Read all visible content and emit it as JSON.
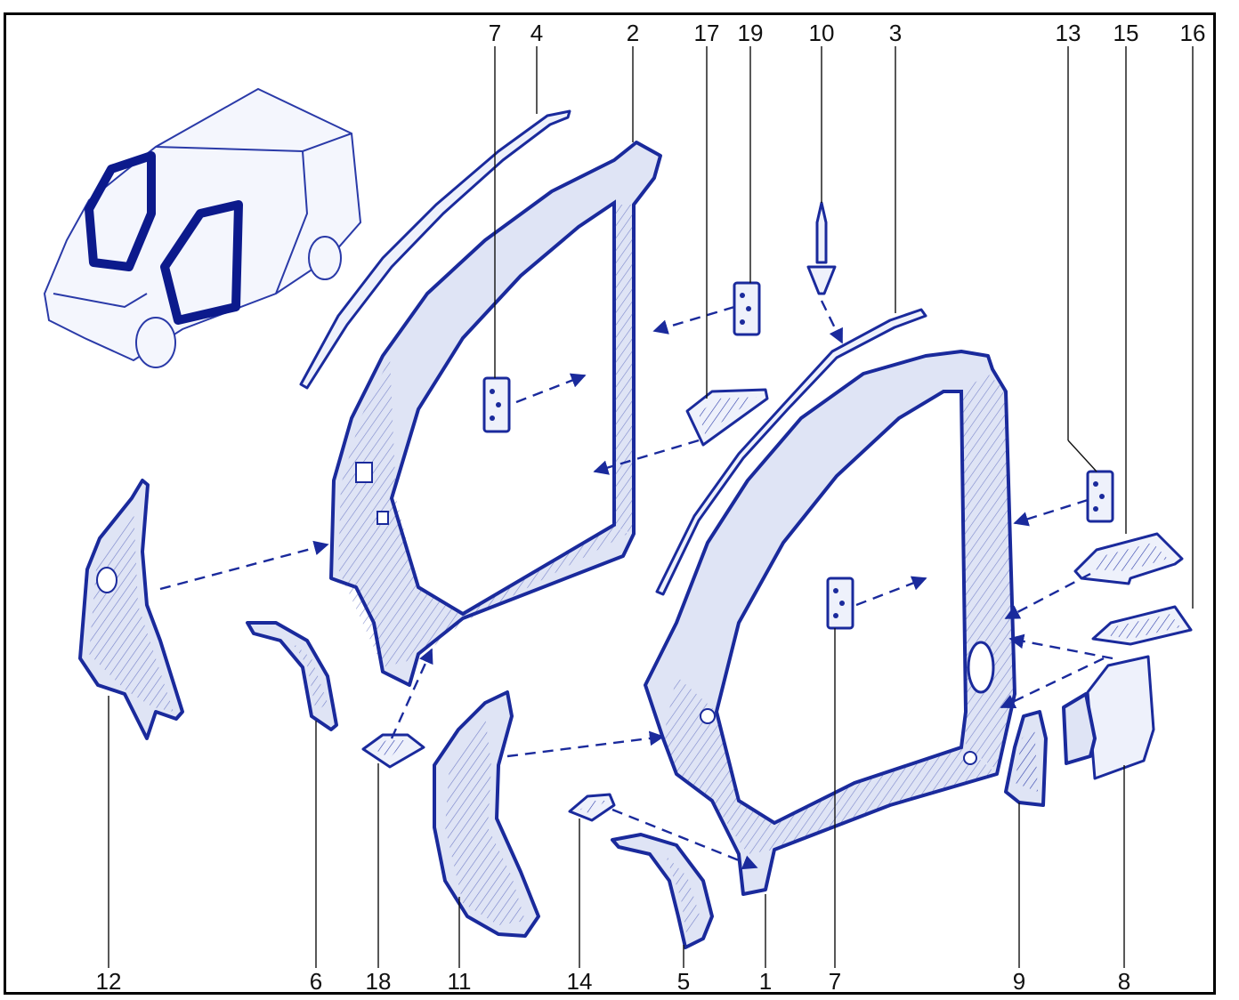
{
  "callouts": {
    "top": [
      "7",
      "4",
      "2",
      "17",
      "19",
      "10",
      "3",
      "13",
      "15",
      "16"
    ],
    "bottom": [
      "12",
      "6",
      "18",
      "11",
      "14",
      "5",
      "1",
      "7",
      "9",
      "8"
    ]
  },
  "colors": {
    "line": "#1a2a9c",
    "fill": "#dfe4f5",
    "frame": "#000000"
  }
}
